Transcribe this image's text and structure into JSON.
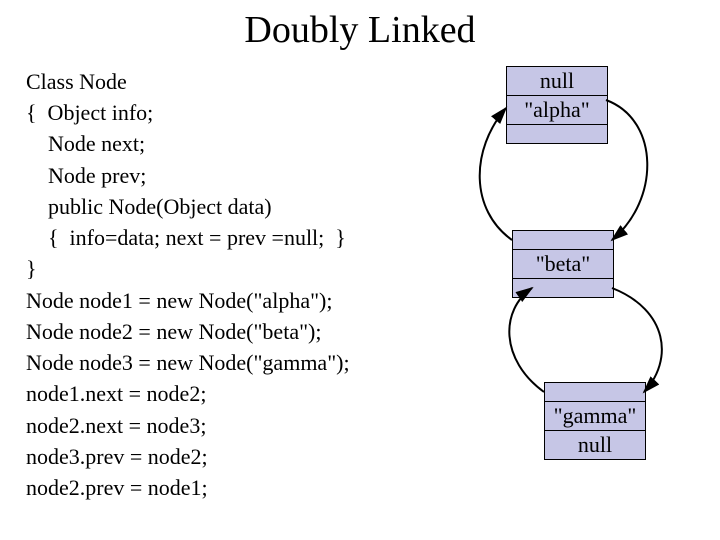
{
  "title": "Doubly Linked",
  "code": {
    "l1": "Class Node",
    "l2": "{  Object info;",
    "l3": "    Node next;",
    "l4": "    Node prev;",
    "l5": "    public Node(Object data)",
    "l6": "    {  info=data; next = prev =null;  }",
    "l7": "}",
    "l8": "Node node1 = new Node(\"alpha\");",
    "l9": "Node node2 = new Node(\"beta\");",
    "l10": "Node node3 = new Node(\"gamma\");",
    "l11": "node1.next = node2;",
    "l12": "node2.next = node3;",
    "l13": "node3.prev = node2;",
    "l14": "node2.prev = node1;"
  },
  "nodes": {
    "n1": {
      "prev": "null",
      "info": "\"alpha\"",
      "next": ""
    },
    "n2": {
      "prev": "",
      "info": "\"beta\"",
      "next": ""
    },
    "n3": {
      "prev": "",
      "info": "\"gamma\"",
      "next": "null"
    }
  }
}
